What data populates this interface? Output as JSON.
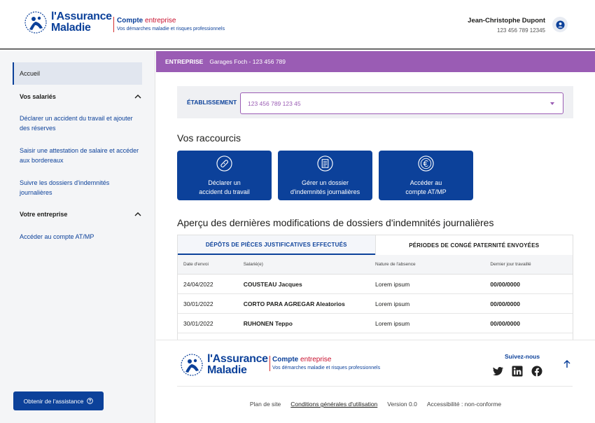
{
  "header": {
    "logo_line1": "l'Assurance",
    "logo_line2": "Maladie",
    "brand_compte": "Compte",
    "brand_entreprise": "entreprise",
    "brand_tagline": "Vos démarches maladie et risques professionnels",
    "user_name": "Jean-Christophe Dupont",
    "user_number": "123 456 789 12345"
  },
  "sidebar": {
    "active": "Accueil",
    "section1": "Vos salariés",
    "items1": [
      "Déclarer un accident du travail et ajouter des réserves",
      "Saisir une attestation de salaire et accéder aux bordereaux",
      "Suivre les dossiers d'indemnités journalières"
    ],
    "section2": "Votre entreprise",
    "items2": [
      "Accéder au compte AT/MP"
    ],
    "assist_label": "Obtenir de l'assistance"
  },
  "enterprise_bar": {
    "label": "ENTREPRISE",
    "value": "Garages Foch - 123 456 789"
  },
  "etablissement": {
    "label": "ÉTABLISSEMENT",
    "selected": "123 456 789 123 45"
  },
  "shortcuts": {
    "title": "Vos raccourcis",
    "items": [
      {
        "line1": "Déclarer un",
        "line2": "accident du travail",
        "icon": "bandage-icon"
      },
      {
        "line1": "Gérer un dossier",
        "line2": "d'indemnités journalières",
        "icon": "document-icon"
      },
      {
        "line1": "Accéder au",
        "line2": "compte AT/MP",
        "icon": "euro-icon"
      }
    ]
  },
  "overview": {
    "title": "Aperçu des dernières modifications de dossiers d'indemnités journalières",
    "tabs": [
      "DÉPÔTS DE PIÈCES JUSTIFICATIVES EFFECTUÉS",
      "PÉRIODES DE CONGÉ PATERNITÉ ENVOYÉES"
    ],
    "columns": [
      "Date d'envoi",
      "Salarié(e)",
      "Nature de l'absence",
      "Dernier jour travaillé"
    ],
    "rows": [
      [
        "24/04/2022",
        "COUSTEAU Jacques",
        "Lorem ipsum",
        "00/00/0000"
      ],
      [
        "30/01/2022",
        "CORTO PARA AGREGAR Aleatorios",
        "Lorem ipsum",
        "00/00/0000"
      ],
      [
        "30/01/2022",
        "RUHONEN Teppo",
        "Lorem ipsum",
        "00/00/0000"
      ]
    ]
  },
  "footer": {
    "follow": "Suivez-nous",
    "links": [
      "Plan de site",
      "Conditions générales d'utilisation",
      "Version 0.0",
      "Accessibilité : non-conforme"
    ]
  },
  "colors": {
    "primary": "#0c419a",
    "purple": "#9a5cb4",
    "accent_red": "#c8102e"
  }
}
